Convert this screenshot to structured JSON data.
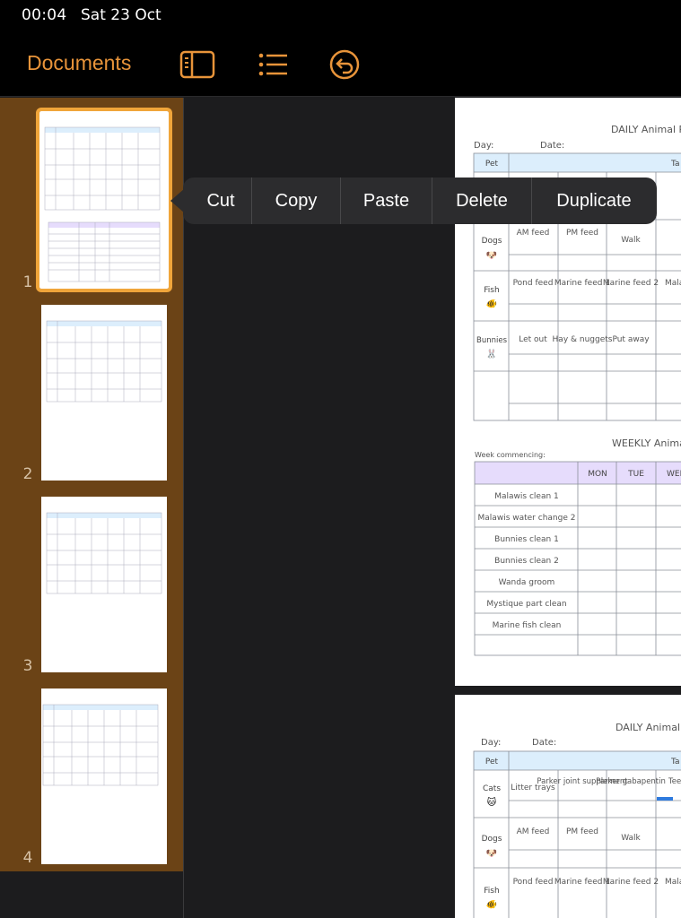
{
  "status": {
    "time": "00:04",
    "date": "Sat 23 Oct"
  },
  "toolbar": {
    "documents_label": "Documents",
    "icons": [
      "sidebar-icon",
      "list-icon",
      "undo-icon"
    ]
  },
  "accent_color": "#e8943a",
  "sidebar": {
    "pages": [
      {
        "number": "1",
        "selected": true
      },
      {
        "number": "2"
      },
      {
        "number": "3"
      },
      {
        "number": "4"
      }
    ]
  },
  "context_menu": {
    "items": [
      "Cut",
      "Copy",
      "Paste",
      "Delete",
      "Duplicate"
    ]
  },
  "document": {
    "daily_title": "DAILY Animal R",
    "day_label": "Day:",
    "date_label": "Date:",
    "pet_header": "Pet",
    "task_header": "Ta",
    "rows": [
      {
        "pet": "Cats",
        "emoji": "🐱",
        "tasks": [
          "Litter trays",
          "Parker joint supplement",
          "Parker gabapentin",
          "Tee clea"
        ]
      },
      {
        "pet": "Dogs",
        "emoji": "🐶",
        "tasks": [
          "AM feed",
          "PM feed",
          "Walk"
        ]
      },
      {
        "pet": "Fish",
        "emoji": "🐠",
        "tasks": [
          "Pond feed",
          "Marine feed 1",
          "Marine feed 2",
          "Mala fe"
        ]
      },
      {
        "pet": "Bunnies",
        "emoji": "🐰",
        "tasks": [
          "Let out",
          "Hay & nuggets",
          "Put away"
        ]
      }
    ],
    "weekly_title": "WEEKLY Animal R",
    "week_label": "Week commencing:",
    "days": [
      "MON",
      "TUE",
      "WED"
    ],
    "weekly_tasks": [
      "Malawis clean 1",
      "Malawis water change 2",
      "Bunnies clean 1",
      "Bunnies clean 2",
      "Wanda groom",
      "Mystique part clean",
      "Marine fish clean"
    ]
  }
}
